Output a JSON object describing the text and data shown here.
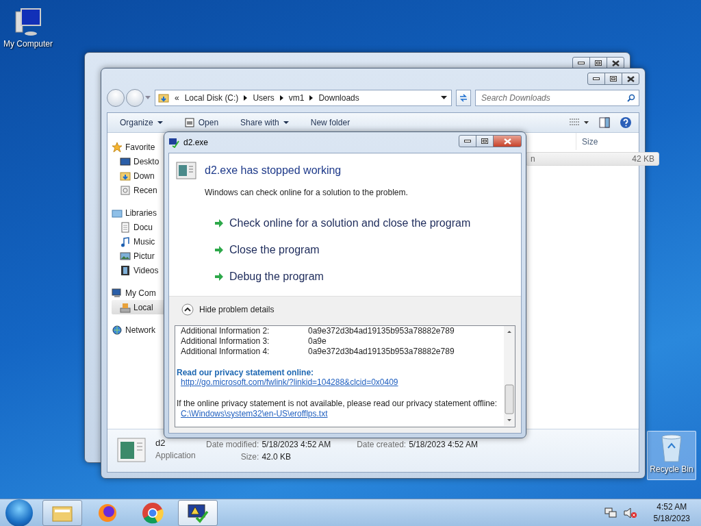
{
  "desktop_icons": [
    {
      "label": "My Computer",
      "kind": "computer",
      "selected": false
    },
    {
      "label": "Recycle Bin",
      "kind": "recycle",
      "selected": true
    }
  ],
  "explorer": {
    "address": {
      "overflow": "«",
      "crumbs": [
        "Local Disk (C:)",
        "Users",
        "vm1",
        "Downloads"
      ]
    },
    "search": {
      "placeholder": "Search Downloads"
    },
    "toolbar": [
      {
        "label": "Organize",
        "kind": "menu"
      },
      {
        "label": "Open",
        "kind": "open"
      },
      {
        "label": "Share with",
        "kind": "menu"
      },
      {
        "label": "New folder",
        "kind": "plain"
      }
    ],
    "sidebar": [
      {
        "label": "Favorite",
        "kind": "star",
        "selected": false,
        "children": [
          {
            "label": "Deskto",
            "kind": "desktop",
            "selected": false
          },
          {
            "label": "Down",
            "kind": "folder",
            "selected": false
          },
          {
            "label": "Recen",
            "kind": "recent",
            "selected": false
          }
        ]
      },
      {
        "label": "Libraries",
        "kind": "library",
        "selected": false,
        "children": [
          {
            "label": "Docu",
            "kind": "document",
            "selected": false
          },
          {
            "label": "Music",
            "kind": "music",
            "selected": false
          },
          {
            "label": "Pictur",
            "kind": "picture",
            "selected": false
          },
          {
            "label": "Videos",
            "kind": "video",
            "selected": false
          }
        ]
      },
      {
        "label": "My Com",
        "kind": "computer",
        "selected": false,
        "children": [
          {
            "label": "Local",
            "kind": "drive",
            "selected": true
          }
        ]
      },
      {
        "label": "Network",
        "kind": "network",
        "selected": false
      }
    ],
    "columns": [
      {
        "label": "Size"
      }
    ],
    "rows": [
      {
        "name": "n",
        "size": "42 KB",
        "selected": true
      }
    ],
    "details": {
      "name": "d2",
      "type": "Application",
      "fields": [
        {
          "label": "Date modified:",
          "value": "5/18/2023 4:52 AM"
        },
        {
          "label": "Date created:",
          "value": "5/18/2023 4:52 AM"
        },
        {
          "label": "Size:",
          "value": "42.0 KB"
        }
      ]
    }
  },
  "dialog": {
    "title": "d2.exe",
    "heading": "d2.exe has stopped working",
    "message": "Windows can check online for a solution to the problem.",
    "actions": [
      "Check online for a solution and close the program",
      "Close the program",
      "Debug the program"
    ],
    "details_toggle": {
      "label": "Hide problem details",
      "expanded": true
    },
    "details": {
      "rows": [
        {
          "label": "Additional Information 2:",
          "value": "0a9e372d3b4ad19135b953a78882e789"
        },
        {
          "label": "Additional Information 3:",
          "value": "0a9e"
        },
        {
          "label": "Additional Information 4:",
          "value": "0a9e372d3b4ad19135b953a78882e789"
        }
      ],
      "privacy_heading": "Read our privacy statement online:",
      "privacy_link": "http://go.microsoft.com/fwlink/?linkid=104288&clcid=0x0409",
      "offline_note": "If the online privacy statement is not available, please read our privacy statement offline:",
      "offline_link": "C:\\Windows\\system32\\en-US\\erofflps.txt"
    }
  },
  "taskbar": {
    "apps": [
      {
        "kind": "explorer",
        "open": true,
        "selected": false
      },
      {
        "kind": "firefox",
        "open": false,
        "selected": false
      },
      {
        "kind": "chrome",
        "open": false,
        "selected": false
      },
      {
        "kind": "problem-report",
        "open": true,
        "selected": true
      }
    ],
    "clock": {
      "time": "4:52 AM",
      "date": "5/18/2023"
    }
  }
}
